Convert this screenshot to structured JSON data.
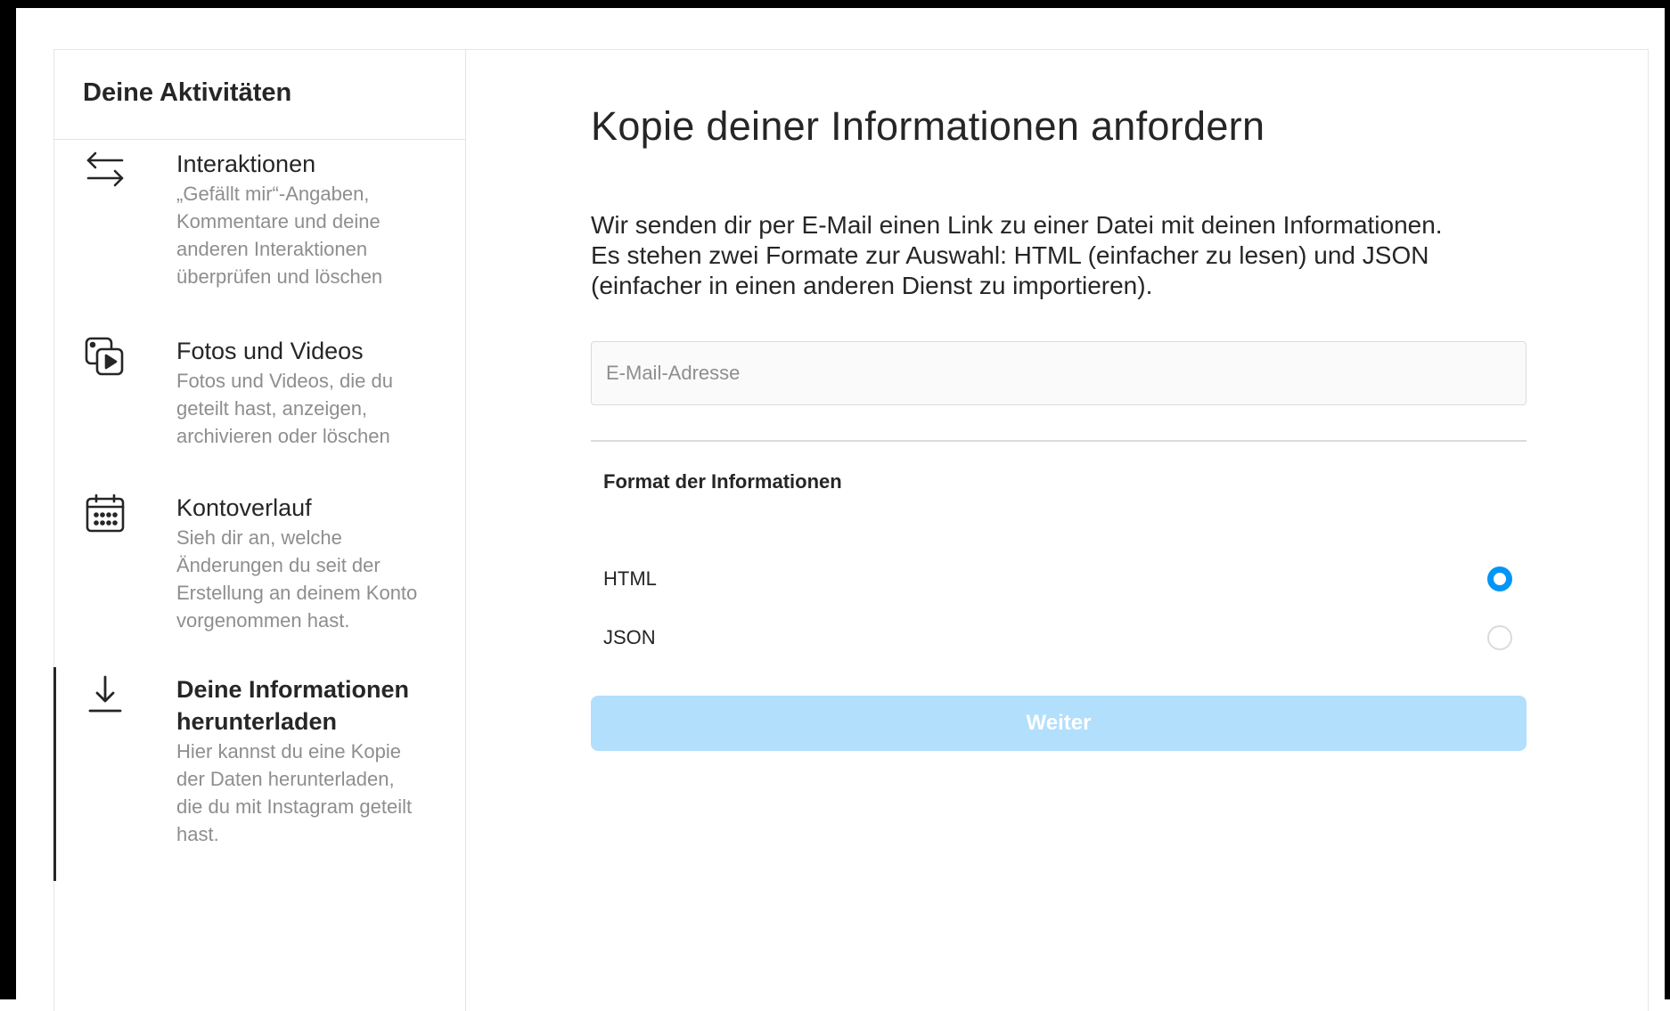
{
  "sidebar": {
    "title": "Deine Aktivitäten",
    "items": [
      {
        "icon": "swap-arrows-icon",
        "title": "Interaktionen",
        "desc": [
          "„Gefällt mir“-Angaben,",
          "Kommentare und deine",
          "anderen Interaktionen",
          "überprüfen und löschen"
        ]
      },
      {
        "icon": "photos-videos-icon",
        "title": "Fotos und Videos",
        "desc": [
          "Fotos und Videos, die du",
          "geteilt hast, anzeigen,",
          "archivieren oder löschen"
        ]
      },
      {
        "icon": "calendar-icon",
        "title": "Kontoverlauf",
        "desc": [
          "Sieh dir an, welche",
          "Änderungen du seit der",
          "Erstellung an deinem Konto",
          "vorgenommen hast."
        ]
      },
      {
        "icon": "download-icon",
        "title_lines": [
          "Deine Informationen",
          "herunterladen"
        ],
        "desc": [
          "Hier kannst du eine Kopie",
          "der Daten herunterladen,",
          "die du mit Instagram geteilt",
          "hast."
        ],
        "active": true
      }
    ]
  },
  "main": {
    "heading": "Kopie deiner Informationen anfordern",
    "intro": [
      "Wir senden dir per E-Mail einen Link zu einer Datei mit deinen Informationen.",
      "Es stehen zwei Formate zur Auswahl: HTML (einfacher zu lesen) und JSON",
      "(einfacher in einen anderen Dienst zu importieren)."
    ],
    "email": {
      "placeholder": "E-Mail-Adresse",
      "value": ""
    },
    "format_label": "Format der Informationen",
    "options": [
      {
        "label": "HTML",
        "selected": true
      },
      {
        "label": "JSON",
        "selected": false
      }
    ],
    "submit_label": "Weiter"
  },
  "colors": {
    "accent": "#0095f6",
    "button_disabled": "#b2dffc",
    "text_primary": "#262626",
    "text_secondary": "#8e8e8e",
    "border": "#dbdbdb"
  }
}
